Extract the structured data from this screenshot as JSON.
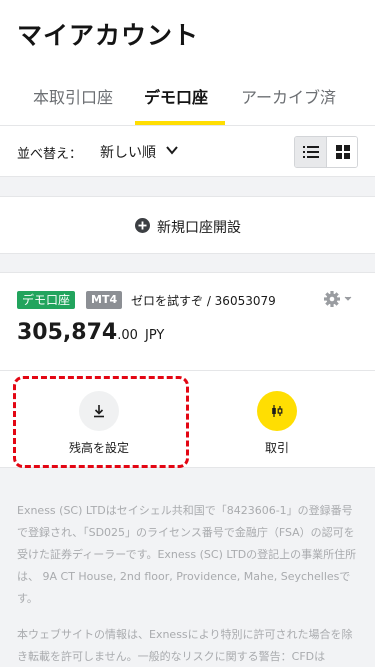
{
  "header": {
    "title": "マイアカウント",
    "tabs": [
      {
        "label": "本取引口座",
        "active": false
      },
      {
        "label": "デモ口座",
        "active": true
      },
      {
        "label": "アーカイブ済",
        "active": false
      }
    ],
    "accent_color": "#ffde02"
  },
  "sort": {
    "label": "並べ替え：",
    "value": "新しい順",
    "chevron_icon": "chevron-down-icon",
    "view_list_icon": "list-view-icon",
    "view_grid_icon": "grid-view-icon"
  },
  "new_account": {
    "label": "新規口座開設",
    "icon": "plus-circle-icon"
  },
  "account": {
    "type_badge": "デモ口座",
    "type_badge_color": "#22a45d",
    "platform_badge": "MT4",
    "name_number": "ゼロを試すぞ / 36053079",
    "balance_int": "305,874",
    "balance_dec": ".00",
    "currency": "JPY",
    "settings_icon": "gear-icon",
    "actions": {
      "set_balance": {
        "label": "残高を設定",
        "icon": "download-icon"
      },
      "trade": {
        "label": "取引",
        "icon": "candlestick-icon"
      }
    }
  },
  "highlight_color": "#e30613",
  "footer": {
    "paragraph1": "Exness (SC) LTDはセイシェル共和国で「8423606-1」の登録番号で登録され、「SD025」のライセンス番号で金融庁（FSA）の認可を受けた証券ディーラーです。Exness (SC) LTDの登記上の事業所住所は、 9A CT House, 2nd floor, Providence, Mahe, Seychellesです。",
    "paragraph2": "本ウェブサイトの情報は、Exnessにより特別に許可された場合を除き転載を許可しません。一般的なリスクに関する警告：CFDは"
  }
}
